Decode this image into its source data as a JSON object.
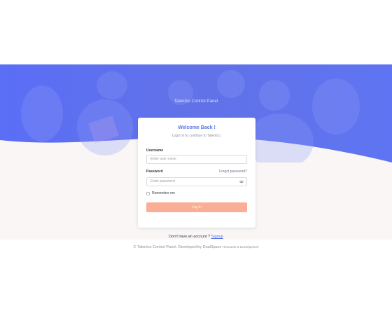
{
  "hero": {
    "title": "Talentco Control Panel"
  },
  "login_card": {
    "title": "Welcome Back !",
    "subtitle": "Login in to continue to Talentco.",
    "username_label": "Username",
    "username_placeholder": "Enter user name",
    "password_label": "Password",
    "forgot_link": "Forgot password?",
    "password_placeholder": "Enter password",
    "remember_label": "Remember me",
    "login_button": "Log In"
  },
  "signup": {
    "prompt": "Don't have an account ?",
    "link": "Signup"
  },
  "footer": {
    "prefix": "© Talentco Control Panel. Developed by DualSpace",
    "suffix": "Research & Development"
  },
  "colors": {
    "hero_blue": "#5b73e8",
    "accent": "#5b73e8",
    "button": "#fbae96",
    "page_bg": "#f9f6f5"
  },
  "icons": {
    "password_toggle": "eye-icon"
  }
}
